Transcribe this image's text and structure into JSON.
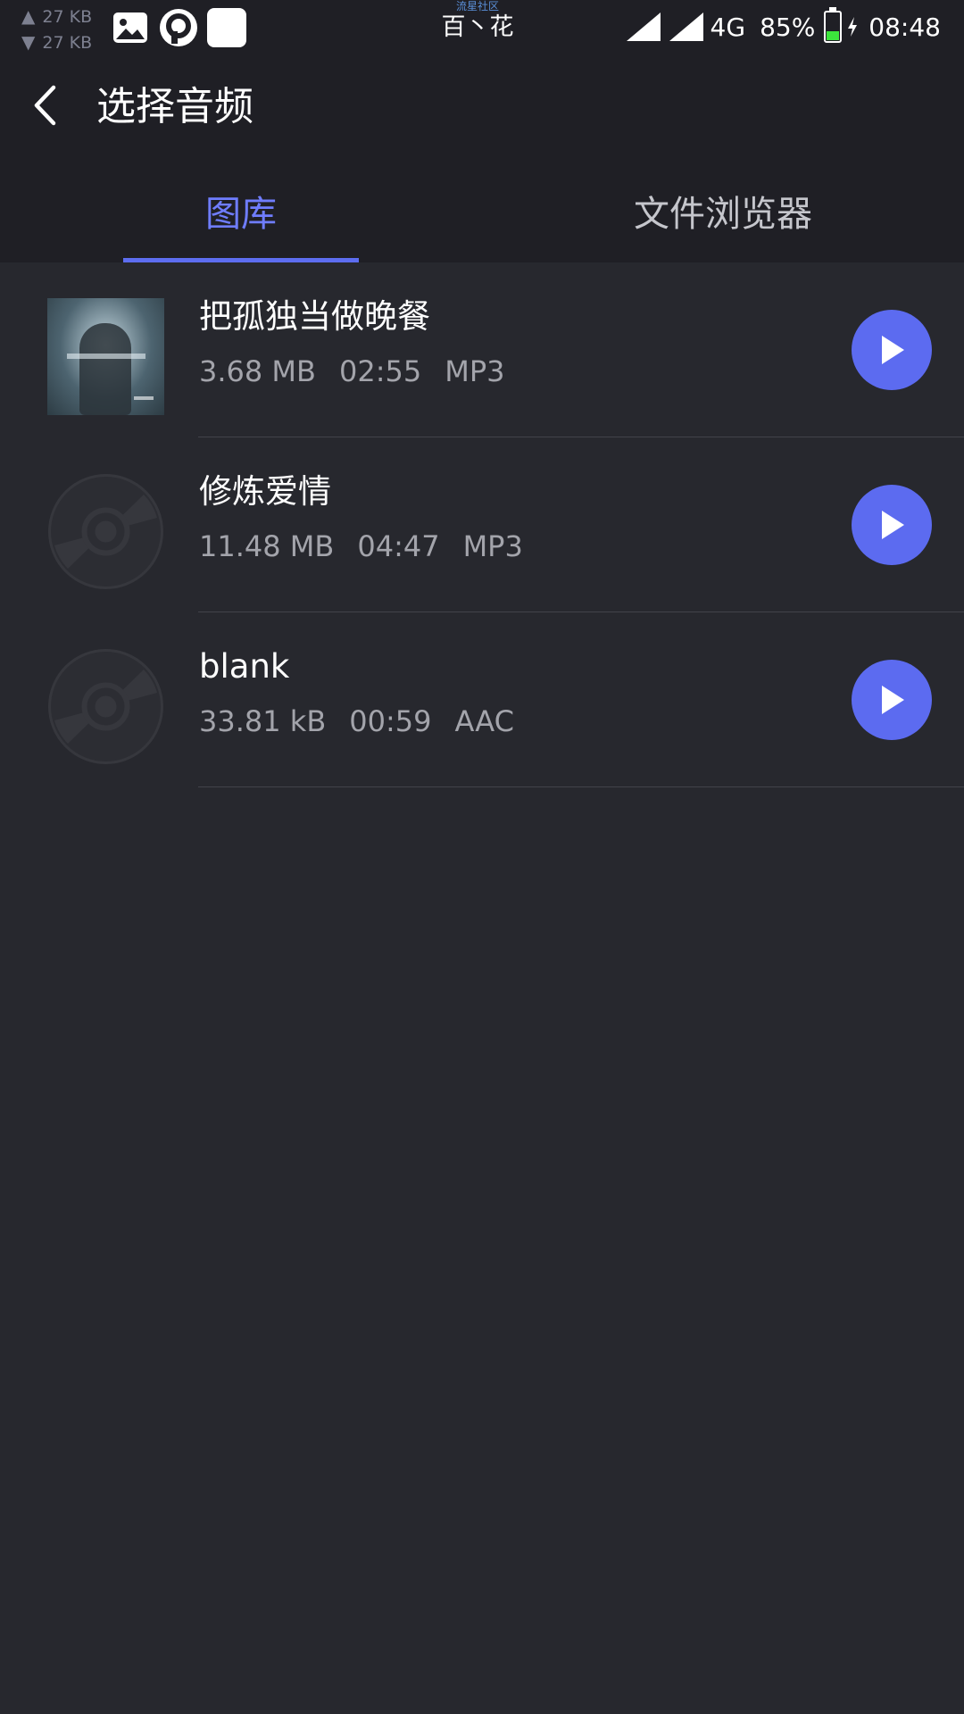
{
  "status_bar": {
    "upload_speed": "27 KB",
    "download_speed": "27 KB",
    "carrier_small": "流星社区",
    "carrier_name": "百丶花",
    "network": "4G",
    "battery": "85%",
    "time": "08:48"
  },
  "header": {
    "title": "选择音频"
  },
  "tabs": [
    {
      "label": "图库",
      "active": true
    },
    {
      "label": "文件浏览器",
      "active": false
    }
  ],
  "songs": [
    {
      "title": "把孤独当做晚餐",
      "size": "3.68 MB",
      "duration": "02:55",
      "format": "MP3",
      "thumbnail": "album-cover"
    },
    {
      "title": "修炼爱情",
      "size": "11.48 MB",
      "duration": "04:47",
      "format": "MP3",
      "thumbnail": "disc-icon"
    },
    {
      "title": "blank",
      "size": "33.81 kB",
      "duration": "00:59",
      "format": "AAC",
      "thumbnail": "disc-icon"
    }
  ],
  "colors": {
    "accent": "#5c6bf0",
    "active_tab_text": "#6f7dff",
    "background": "#27282e",
    "top_background": "#1f1f25"
  }
}
